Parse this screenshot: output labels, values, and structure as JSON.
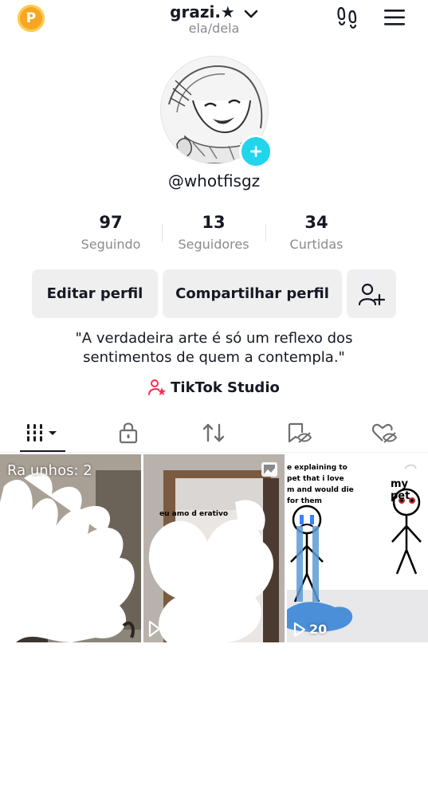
{
  "header": {
    "coin_letter": "P",
    "display_name": "grazi.★",
    "pronouns": "ela/dela",
    "icons": [
      "coin-icon",
      "chevron-down-icon",
      "footprints-icon",
      "menu-icon"
    ]
  },
  "profile": {
    "username": "@whotfisgz"
  },
  "stats": [
    {
      "value": "97",
      "label": "Seguindo"
    },
    {
      "value": "13",
      "label": "Seguidores"
    },
    {
      "value": "34",
      "label": "Curtidas"
    }
  ],
  "buttons": {
    "edit": "Editar perfil",
    "share": "Compartilhar perfil"
  },
  "bio": {
    "line1": "\"A verdadeira arte é só um reflexo dos",
    "line2": "sentimentos de quem a contempla.\""
  },
  "studio_link": "TikTok Studio",
  "tabs": [
    "videos-grid-icon",
    "lock-icon",
    "repost-icon",
    "hidden-bookmark-icon",
    "hidden-heart-icon"
  ],
  "grid": {
    "drafts_label": "Ra  unhos: 2",
    "video2_caption": "eu amo        d   erativo",
    "video3_text_left": "e explaining to\npet that i love\nm and would die\nfor them",
    "video3_text_right": "my pet",
    "video3_views": "20"
  },
  "colors": {
    "accent_teal": "#20d5ec",
    "coin": "#f6a623",
    "studio_pink": "#fe2c55",
    "text": "#161823",
    "muted": "#8a8b91"
  }
}
